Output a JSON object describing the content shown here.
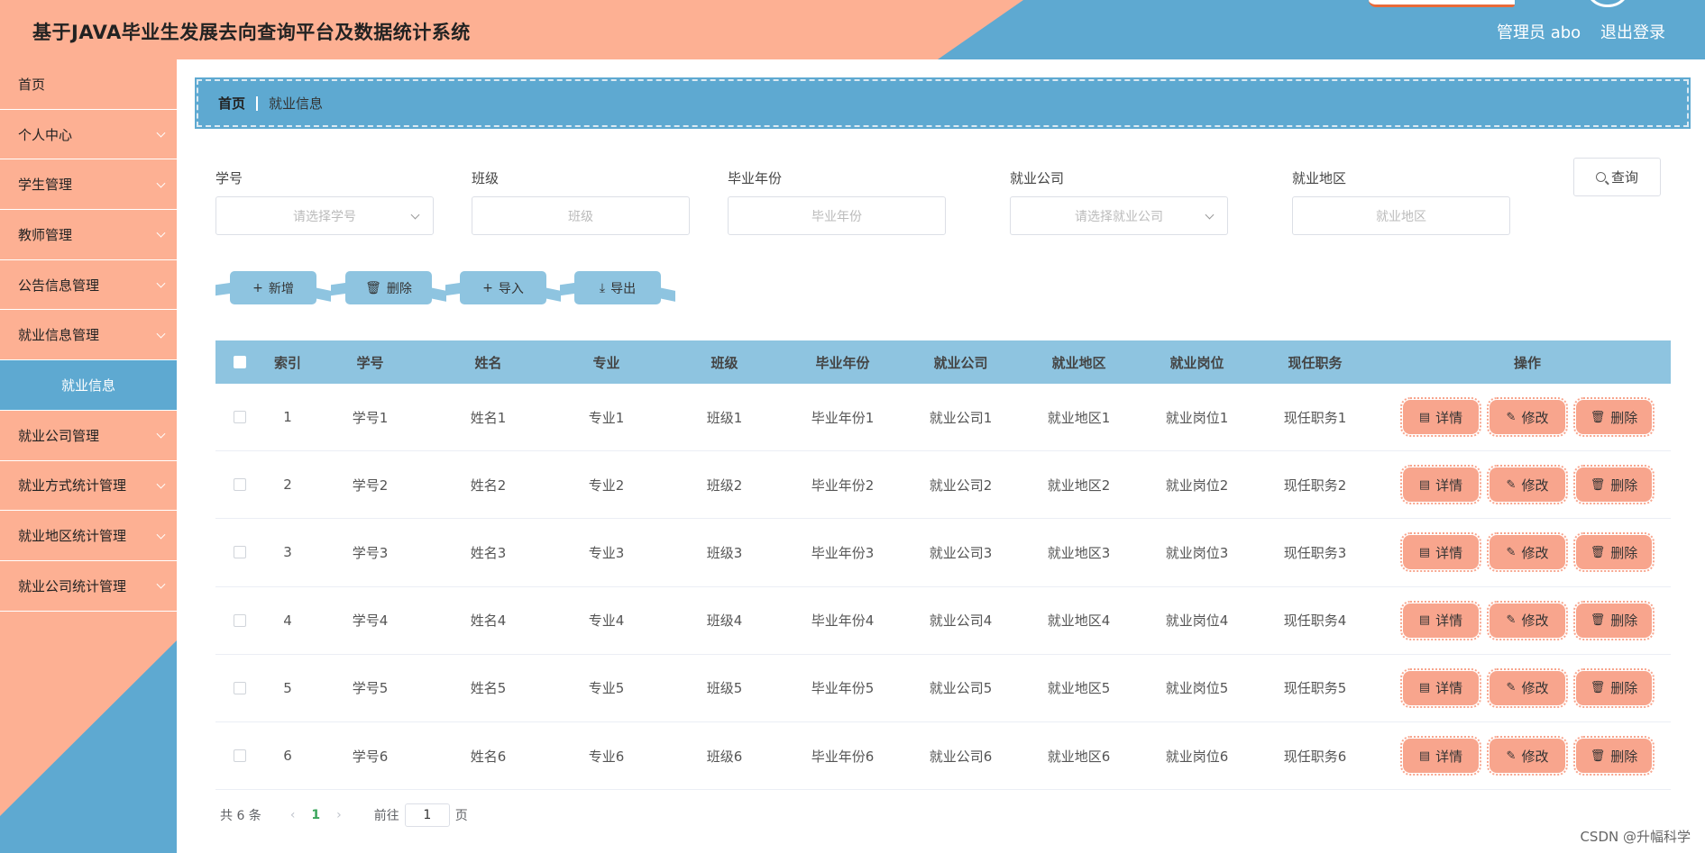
{
  "header": {
    "title": "基于JAVA毕业生发展去向查询平台及数据统计系统",
    "admin": "管理员 abo",
    "logout": "退出登录"
  },
  "sidebar": {
    "items": [
      {
        "label": "首页",
        "chevron": false
      },
      {
        "label": "个人中心",
        "chevron": true
      },
      {
        "label": "学生管理",
        "chevron": true
      },
      {
        "label": "教师管理",
        "chevron": true
      },
      {
        "label": "公告信息管理",
        "chevron": true
      },
      {
        "label": "就业信息管理",
        "chevron": true
      },
      {
        "label": "就业信息",
        "chevron": false,
        "sub": true
      },
      {
        "label": "就业公司管理",
        "chevron": true
      },
      {
        "label": "就业方式统计管理",
        "chevron": true
      },
      {
        "label": "就业地区统计管理",
        "chevron": true
      },
      {
        "label": "就业公司统计管理",
        "chevron": true
      }
    ]
  },
  "breadcrumb": {
    "home": "首页",
    "current": "就业信息"
  },
  "search": {
    "fields": [
      {
        "label": "学号",
        "placeholder": "请选择学号",
        "select": true
      },
      {
        "label": "班级",
        "placeholder": "班级",
        "select": false
      },
      {
        "label": "毕业年份",
        "placeholder": "毕业年份",
        "select": false
      },
      {
        "label": "就业公司",
        "placeholder": "请选择就业公司",
        "select": true
      },
      {
        "label": "就业地区",
        "placeholder": "就业地区",
        "select": false
      }
    ],
    "query_label": "查询"
  },
  "actions": {
    "add": "新增",
    "delete": "删除",
    "import": "导入",
    "export": "导出"
  },
  "table": {
    "headers": [
      "索引",
      "学号",
      "姓名",
      "专业",
      "班级",
      "毕业年份",
      "就业公司",
      "就业地区",
      "就业岗位",
      "现任职务",
      "操作"
    ],
    "ops": {
      "detail": "详情",
      "edit": "修改",
      "delete": "删除"
    },
    "rows": [
      [
        "1",
        "学号1",
        "姓名1",
        "专业1",
        "班级1",
        "毕业年份1",
        "就业公司1",
        "就业地区1",
        "就业岗位1",
        "现任职务1"
      ],
      [
        "2",
        "学号2",
        "姓名2",
        "专业2",
        "班级2",
        "毕业年份2",
        "就业公司2",
        "就业地区2",
        "就业岗位2",
        "现任职务2"
      ],
      [
        "3",
        "学号3",
        "姓名3",
        "专业3",
        "班级3",
        "毕业年份3",
        "就业公司3",
        "就业地区3",
        "就业岗位3",
        "现任职务3"
      ],
      [
        "4",
        "学号4",
        "姓名4",
        "专业4",
        "班级4",
        "毕业年份4",
        "就业公司4",
        "就业地区4",
        "就业岗位4",
        "现任职务4"
      ],
      [
        "5",
        "学号5",
        "姓名5",
        "专业5",
        "班级5",
        "毕业年份5",
        "就业公司5",
        "就业地区5",
        "就业岗位5",
        "现任职务5"
      ],
      [
        "6",
        "学号6",
        "姓名6",
        "专业6",
        "班级6",
        "毕业年份6",
        "就业公司6",
        "就业地区6",
        "就业岗位6",
        "现任职务6"
      ]
    ]
  },
  "pagination": {
    "total": "共 6 条",
    "page": "1",
    "goto_prefix": "前往",
    "goto_value": "1",
    "goto_suffix": "页"
  },
  "watermark": "CSDN @升幅科学"
}
